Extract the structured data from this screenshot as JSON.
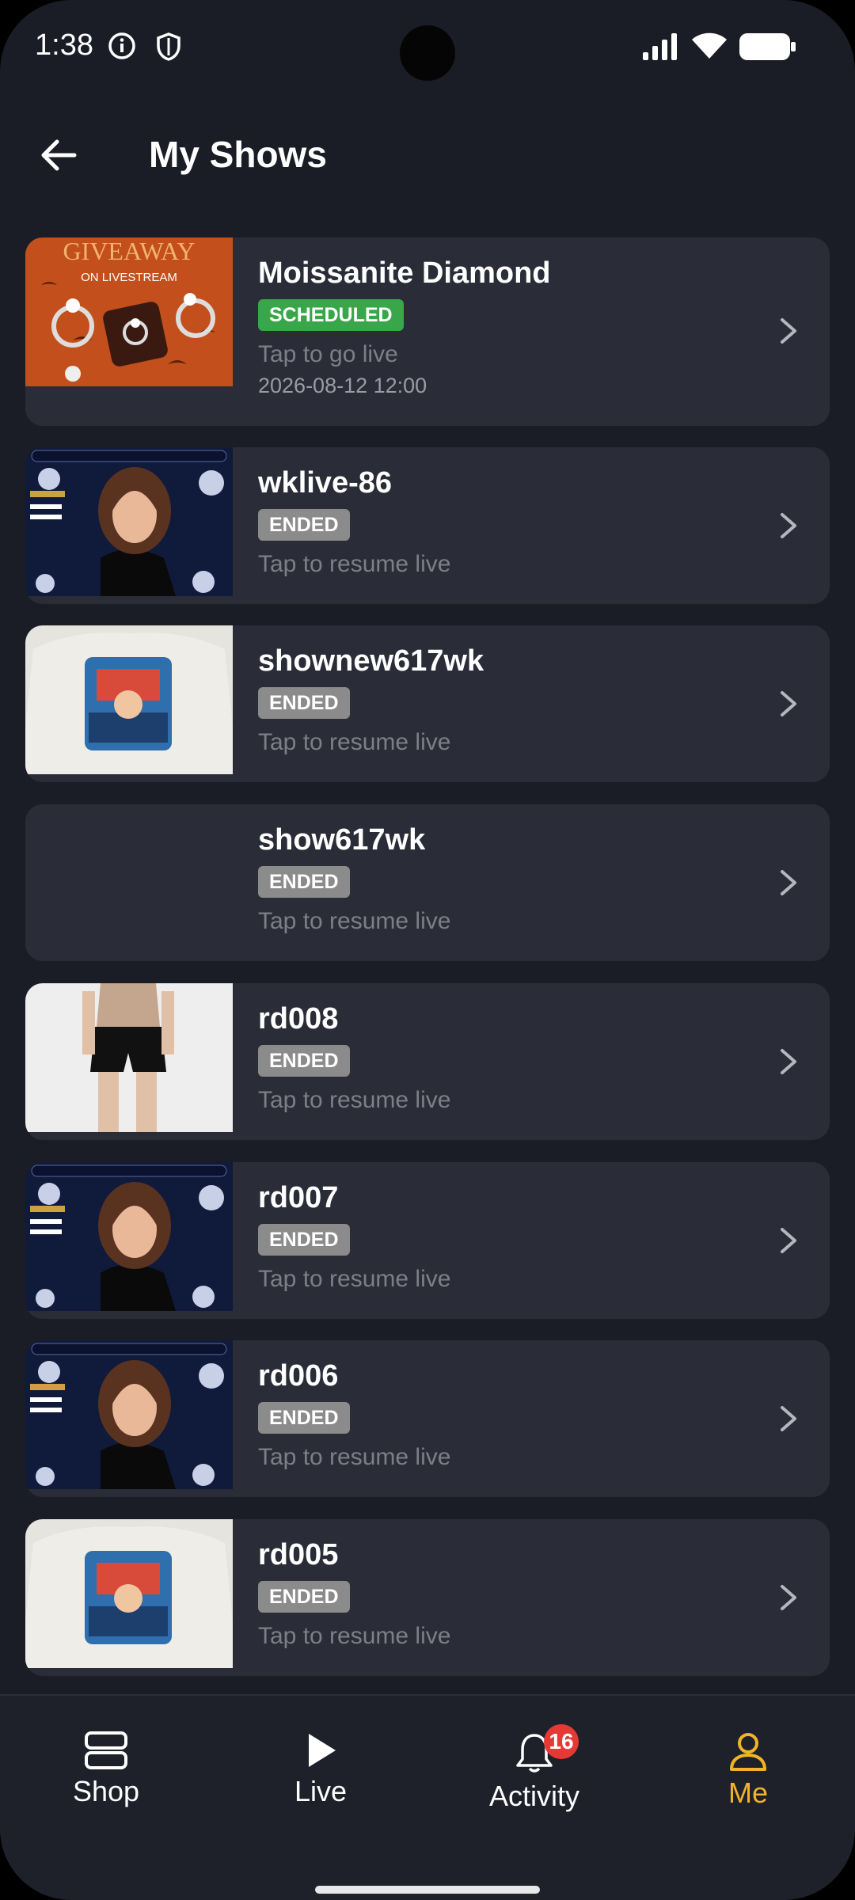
{
  "status_bar": {
    "time": "1:38"
  },
  "header": {
    "title": "My Shows"
  },
  "shows": [
    {
      "name": "Moissanite Diamond",
      "status": "SCHEDULED",
      "subtitle": "Tap to go live",
      "date": "2026-08-12 12:00",
      "thumbnail": "giveaway-rings",
      "thumb_text_1": "GIVEAWAY",
      "thumb_text_2": "ON LIVESTREAM"
    },
    {
      "name": "wklive-86",
      "status": "ENDED",
      "subtitle": "Tap to resume live",
      "thumbnail": "diamond-model"
    },
    {
      "name": "shownew617wk",
      "status": "ENDED",
      "subtitle": "Tap to resume live",
      "thumbnail": "tshirt"
    },
    {
      "name": "show617wk",
      "status": "ENDED",
      "subtitle": "Tap to resume live",
      "thumbnail": "none"
    },
    {
      "name": "rd008",
      "status": "ENDED",
      "subtitle": "Tap to resume live",
      "thumbnail": "shorts-model"
    },
    {
      "name": "rd007",
      "status": "ENDED",
      "subtitle": "Tap to resume live",
      "thumbnail": "diamond-model"
    },
    {
      "name": "rd006",
      "status": "ENDED",
      "subtitle": "Tap to resume live",
      "thumbnail": "diamond-model"
    },
    {
      "name": "rd005",
      "status": "ENDED",
      "subtitle": "Tap to resume live",
      "thumbnail": "tshirt"
    }
  ],
  "nav": {
    "shop": "Shop",
    "live": "Live",
    "activity": "Activity",
    "activity_badge": "16",
    "me": "Me"
  },
  "colors": {
    "background": "#1b1d26",
    "card": "#2a2c37",
    "active": "#f0b429",
    "scheduled": "#3aa64a",
    "ended": "#8b8b8b"
  }
}
